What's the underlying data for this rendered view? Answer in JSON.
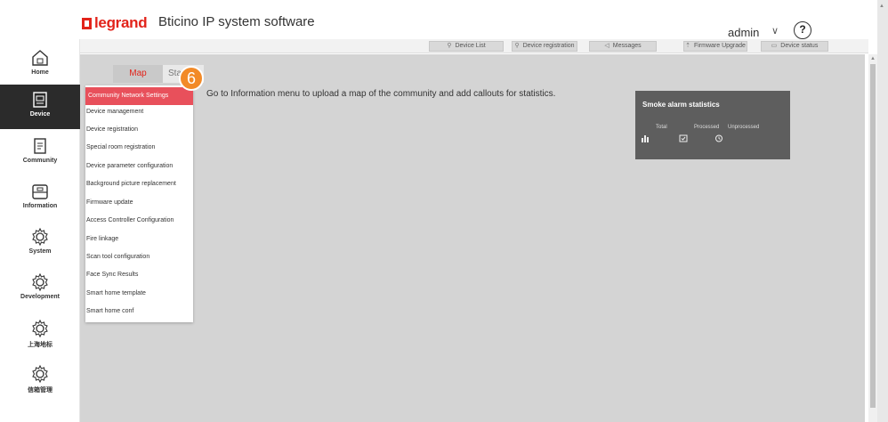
{
  "header": {
    "logo_text": "legrand",
    "app_title": "Bticino IP system software",
    "user": "admin",
    "user_chevron": "∨",
    "help_label": "?"
  },
  "toolbar": {
    "buttons": [
      {
        "icon": "wrench-icon",
        "glyph": "⚲",
        "label": "Device List"
      },
      {
        "icon": "wrench-icon",
        "glyph": "⚲",
        "label": "Device registration"
      },
      {
        "icon": "send-icon",
        "glyph": "◁",
        "label": "Messages"
      },
      {
        "icon": "upload-icon",
        "glyph": "⇡",
        "label": "Firmware Upgrade"
      },
      {
        "icon": "monitor-icon",
        "glyph": "▭",
        "label": "Device status"
      }
    ]
  },
  "sidebar": {
    "items": [
      {
        "label": "Home",
        "icon": "home-icon",
        "active": false
      },
      {
        "label": "Device",
        "icon": "device-icon",
        "active": true
      },
      {
        "label": "Community",
        "icon": "community-icon",
        "active": false
      },
      {
        "label": "Information",
        "icon": "information-icon",
        "active": false
      },
      {
        "label": "System",
        "icon": "gear-icon",
        "active": false
      },
      {
        "label": "Development",
        "icon": "gear-icon",
        "active": false
      },
      {
        "label": "上海地标",
        "icon": "gear-icon",
        "active": false
      },
      {
        "label": "信箱管理",
        "icon": "gear-icon",
        "active": false
      }
    ]
  },
  "tabs": {
    "map": "Map",
    "statistics": "Statis"
  },
  "instruction": "Go to Information menu to upload a map of the community and add callouts for statistics.",
  "dropdown": {
    "items": [
      "Community Network Settings",
      "Device management",
      "Device registration",
      "Special room registration",
      "Device parameter configuration",
      "Background picture replacement",
      "Firmware update",
      "Access Controller Configuration",
      "Fire linkage",
      "Scan tool configuration",
      "Face Sync Results",
      "Smart home template",
      "Smart home conf"
    ],
    "active_index": 0
  },
  "step_badge": "6",
  "stats_card": {
    "title": "Smoke alarm statistics",
    "columns": [
      "Total",
      "Processed",
      "Unprocessed"
    ],
    "icons": [
      "bar-chart-icon",
      "check-box-icon",
      "clock-icon"
    ]
  },
  "colors": {
    "brand_red": "#e2231a",
    "active_nav": "#2b2b2b",
    "menu_active": "#e8505b",
    "badge": "#f28a28",
    "card_bg": "#5e5e5e",
    "canvas_bg": "#d4d4d4"
  }
}
